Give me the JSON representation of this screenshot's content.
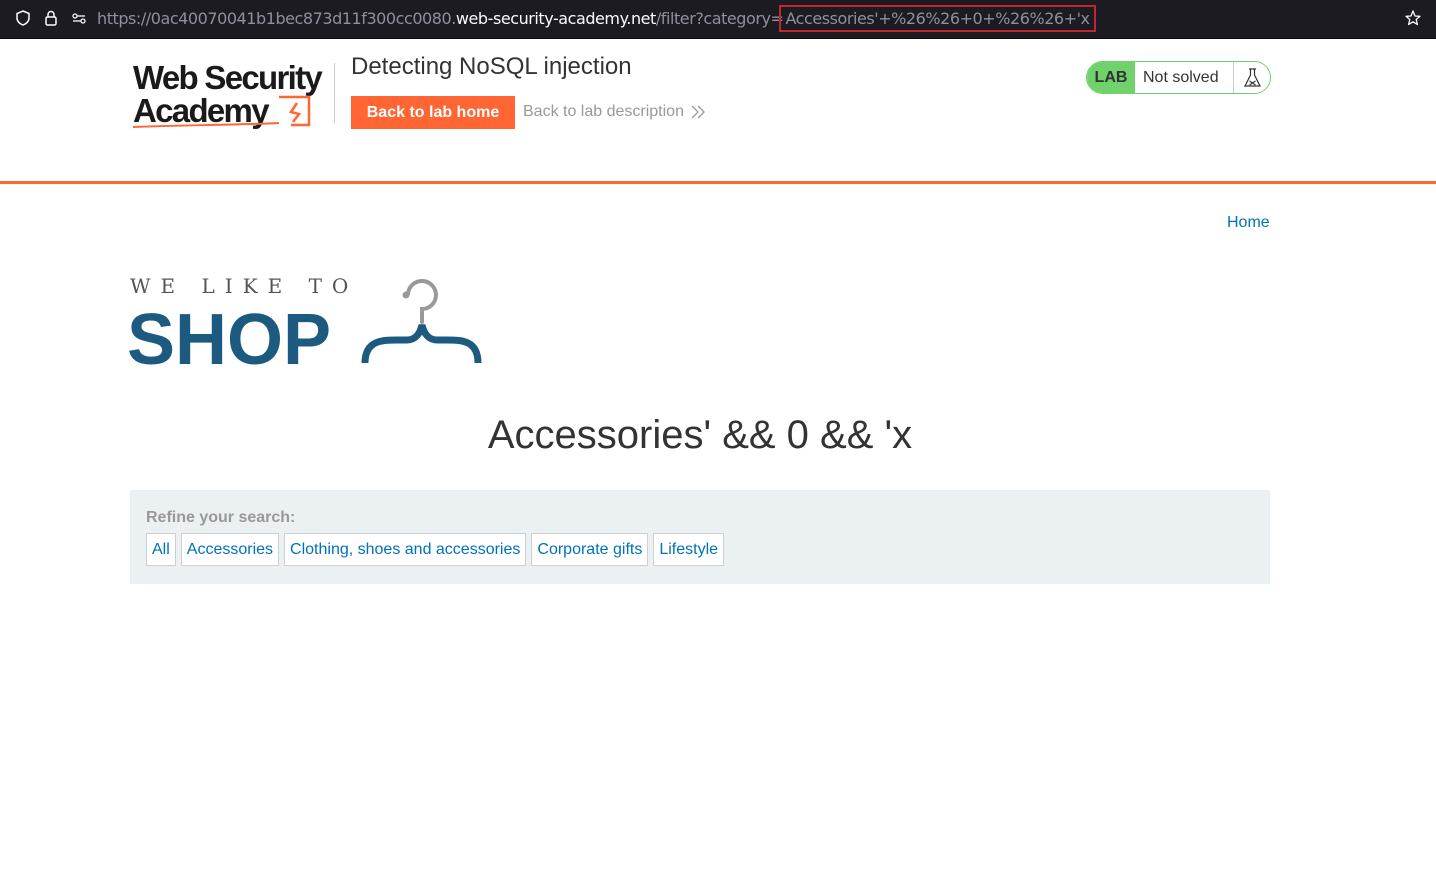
{
  "browser": {
    "url_prefix": "https://0ac40070041b1bec873d11f300cc0080.",
    "url_domain": "web-security-academy.net",
    "url_path": "/filter?category=",
    "url_query_highlight": "Accessories'+%26%26+0+%26%26+'x"
  },
  "lab_header": {
    "logo_line1": "Web Security",
    "logo_line2": "Academy",
    "title": "Detecting NoSQL injection",
    "back_home": "Back to lab home",
    "back_description": "Back to lab description",
    "status_badge": "LAB",
    "status_text": "Not solved",
    "accent": "#ff6633",
    "badge_color": "#70d16d"
  },
  "nav": {
    "home": "Home"
  },
  "shop_logo": {
    "tagline": "WE LIKE TO",
    "word": "SHOP",
    "color": "#1c5a80"
  },
  "page": {
    "heading": "Accessories' && 0 && 'x"
  },
  "filters": {
    "label": "Refine your search:",
    "categories": [
      "All",
      "Accessories",
      "Clothing, shoes and accessories",
      "Corporate gifts",
      "Lifestyle"
    ]
  }
}
